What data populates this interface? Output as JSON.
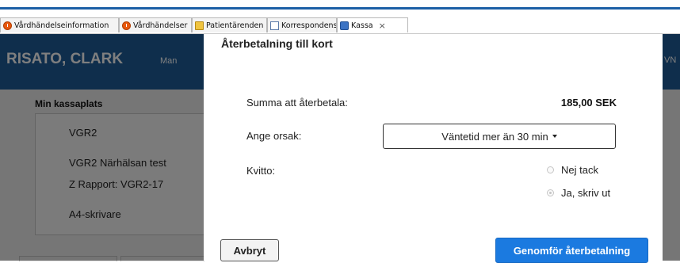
{
  "browser": {
    "tabs": [
      {
        "label": "Vårdhändelseinformation",
        "icon": "clock-icon"
      },
      {
        "label": "Vårdhändelser",
        "icon": "clock-icon"
      },
      {
        "label": "Patientärenden",
        "icon": "folder-icon"
      },
      {
        "label": "Korrespondens",
        "icon": "mail-icon"
      },
      {
        "label": "Kassa",
        "icon": "kassa-icon",
        "active": true
      }
    ],
    "close_glyph": "×"
  },
  "header": {
    "patient_name": "RISATO, CLARK",
    "gender": "Man",
    "right_text": "VN"
  },
  "cash_register": {
    "section_title": "Min kassaplats",
    "lines": [
      "VGR2",
      "VGR2 Närhälsan test",
      "Z Rapport: VGR2-17",
      "A4-skrivare"
    ]
  },
  "modal": {
    "title": "Återbetalning till kort",
    "amount_label": "Summa att återbetala:",
    "amount_value": "185,00 SEK",
    "reason_label": "Ange orsak:",
    "reason_selected": "Väntetid mer än 30 min",
    "receipt_label": "Kvitto:",
    "receipt_options": [
      {
        "label": "Nej tack",
        "checked": false
      },
      {
        "label": "Ja, skriv ut",
        "checked": true
      }
    ],
    "cancel_label": "Avbryt",
    "confirm_label": "Genomför återbetalning"
  },
  "colors": {
    "header_blue": "#1f5c99",
    "primary_button": "#1b7ae0",
    "tab_accent": "#1c5fa6"
  }
}
